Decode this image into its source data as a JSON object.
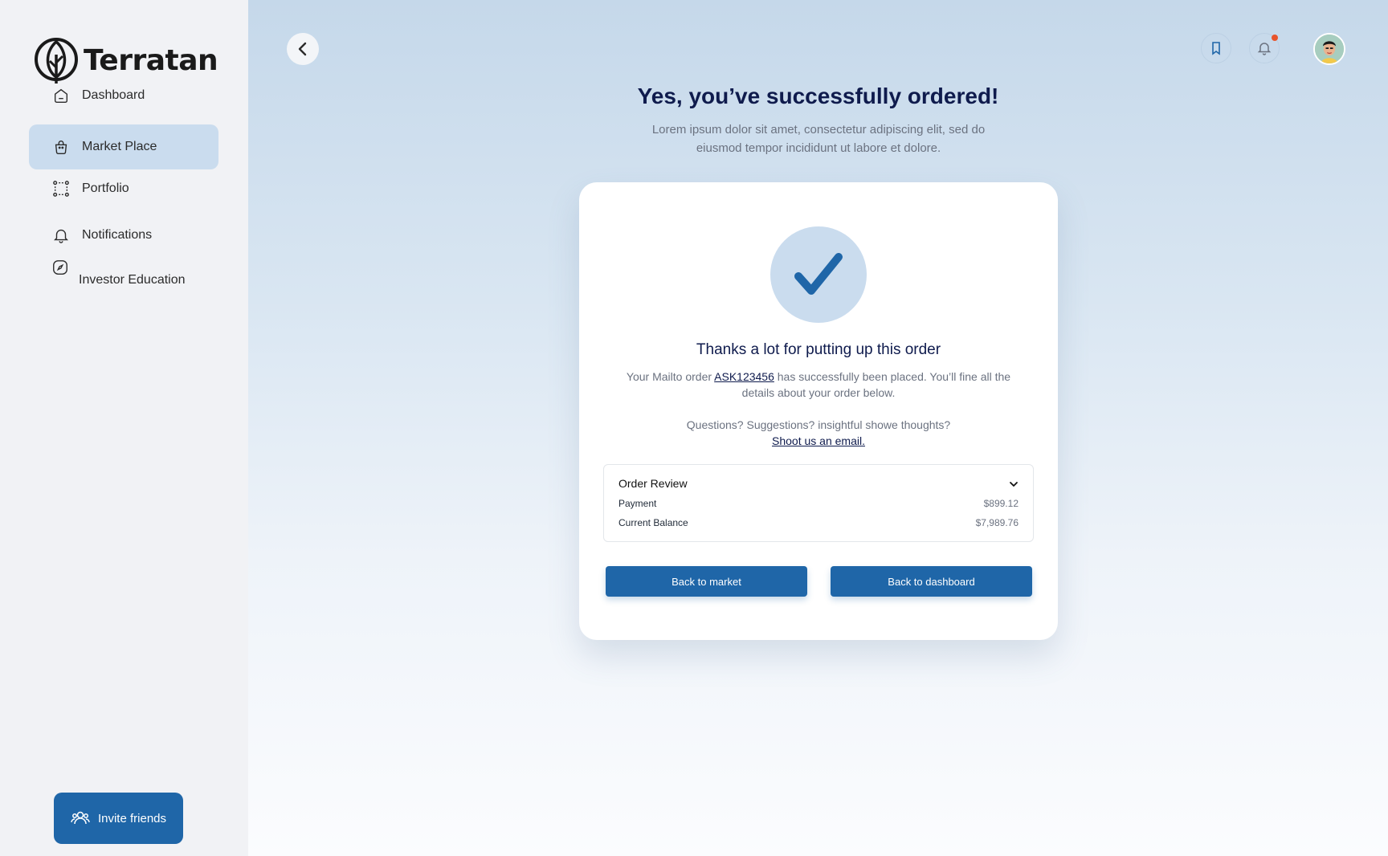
{
  "app": {
    "name": "Terratan"
  },
  "sidebar": {
    "items": [
      {
        "label": "Dashboard",
        "icon": "home-icon"
      },
      {
        "label": "Market Place",
        "icon": "bag-icon",
        "active": true
      },
      {
        "label": "Portfolio",
        "icon": "portfolio-icon"
      },
      {
        "label": "Notifications",
        "icon": "bell-icon"
      },
      {
        "label": "Investor Education",
        "icon": "compass-icon"
      }
    ],
    "invite_label": "Invite friends"
  },
  "header": {
    "icons": [
      "chevron-left-icon",
      "bookmark-icon",
      "bell-icon",
      "avatar"
    ]
  },
  "main": {
    "title": "Yes, you’ve successfully ordered!",
    "subtitle": "Lorem ipsum dolor sit amet, consectetur adipiscing elit, sed do eiusmod tempor incididunt ut labore et dolore."
  },
  "card": {
    "heading": "Thanks a lot for putting up this order",
    "text_before": "Your Mailto order ",
    "order_id": "ASK123456",
    "text_after": " has successfully been placed. You’ll fine all the details about your order below.",
    "question": "Questions? Suggestions? insightful showe thoughts?",
    "email_link": "Shoot us an email.",
    "review": {
      "title": "Order Review",
      "rows": [
        {
          "label": "Payment",
          "value": "$899.12"
        },
        {
          "label": "Current Balance",
          "value": "$7,989.76"
        }
      ]
    },
    "buttons": {
      "market": "Back to market",
      "dashboard": "Back to dashboard"
    }
  },
  "colors": {
    "primary": "#1f66a8",
    "active_nav": "#cadcee",
    "title": "#0f1b4d",
    "notification_dot": "#e8542c"
  }
}
